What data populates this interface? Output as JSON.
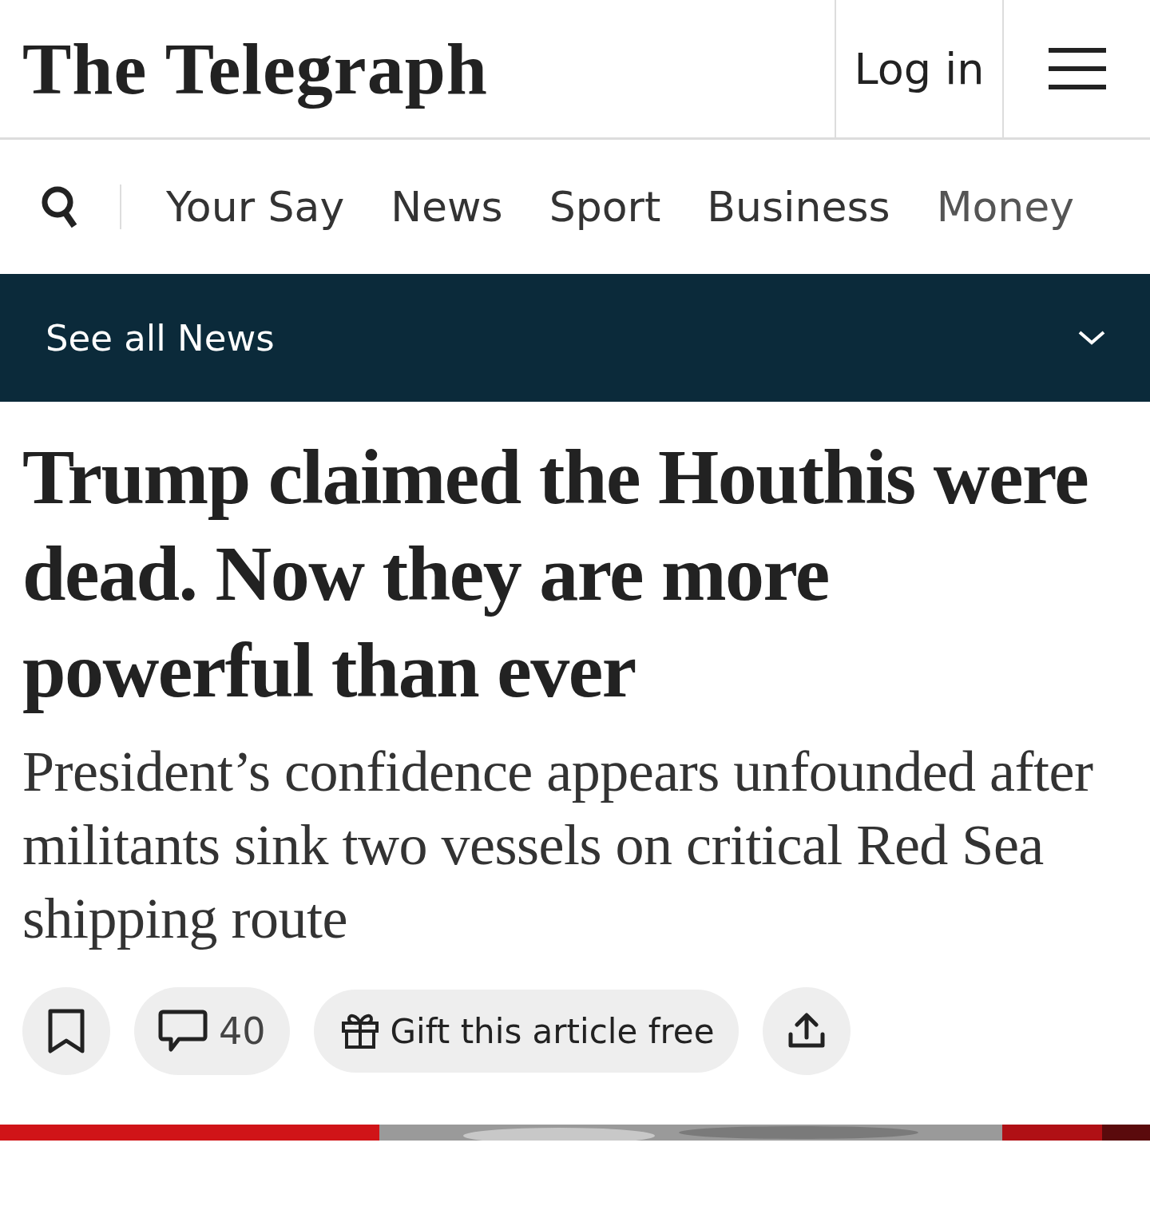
{
  "header": {
    "logo": "The Telegraph",
    "login": "Log in"
  },
  "nav": {
    "items": [
      "Your Say",
      "News",
      "Sport",
      "Business",
      "Money"
    ]
  },
  "section_bar": {
    "label": "See all News"
  },
  "article": {
    "headline": "Trump claimed the Houthis were dead. Now they are more powerful than ever",
    "standfirst": "President’s confidence appears unfounded after militants sink two vessels on critical Red Sea shipping route",
    "actions": {
      "comments": "40",
      "gift": "Gift this article free"
    }
  }
}
